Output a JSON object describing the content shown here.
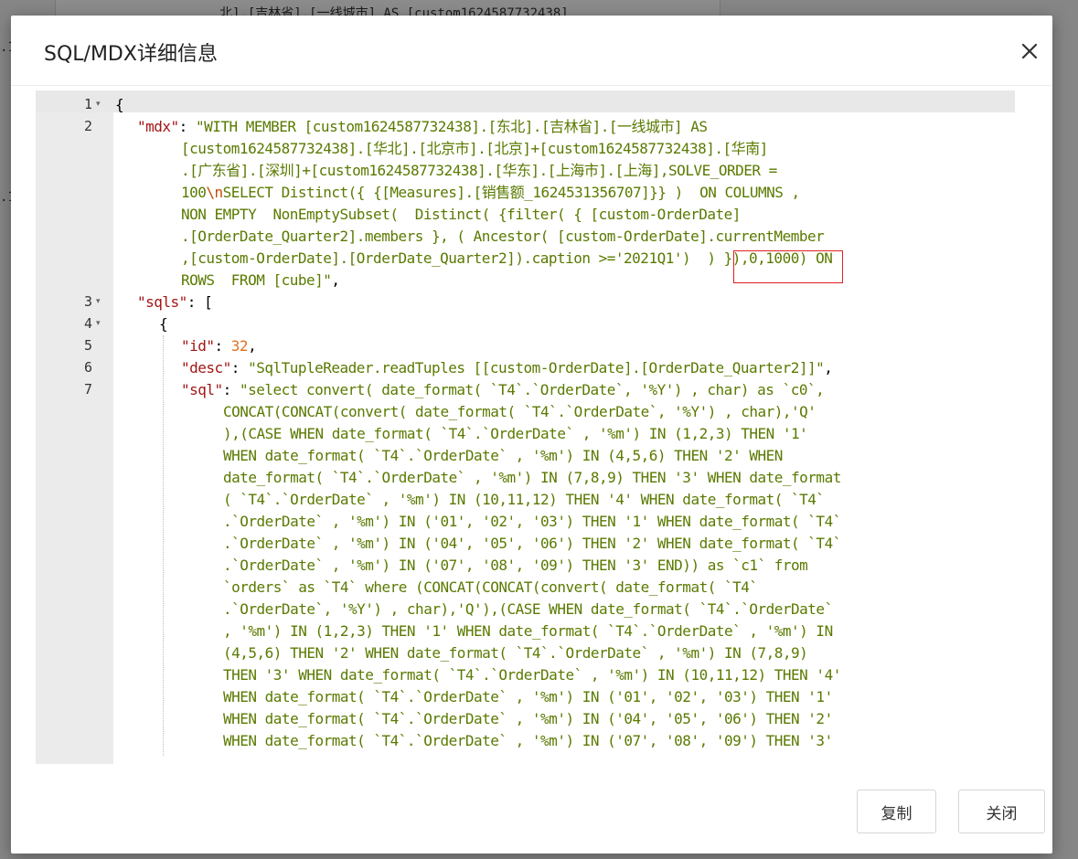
{
  "background": {
    "top_text": "北].[吉林省].[一线城市] AS [custom1624587732438]",
    "side_marks": [
      ".1",
      ".1"
    ]
  },
  "dialog": {
    "title": "SQL/MDX详细信息",
    "close_icon": "close-icon"
  },
  "editor": {
    "line_numbers": [
      "1",
      "2",
      "3",
      "4",
      "5",
      "6",
      "7"
    ],
    "fold_markers": [
      "▾",
      "▾",
      "▾"
    ],
    "lines": [
      {
        "parts": [
          {
            "t": "{",
            "c": ""
          }
        ]
      },
      {
        "parts": [
          {
            "t": "\"mdx\"",
            "c": "k"
          },
          {
            "t": ": ",
            "c": ""
          },
          {
            "t": "\"WITH MEMBER [custom1624587732438].[东北].[吉林省].[一线城市] AS",
            "c": "s"
          }
        ]
      },
      {
        "parts": [
          {
            "t": "[custom1624587732438].[华北].[北京市].[北京]+[custom1624587732438].[华南]",
            "c": "s"
          }
        ]
      },
      {
        "parts": [
          {
            "t": ".[广东省].[深圳]+[custom1624587732438].[华东].[上海市].[上海],SOLVE_ORDER =",
            "c": "s"
          }
        ]
      },
      {
        "parts": [
          {
            "t": "100",
            "c": "s"
          },
          {
            "t": "\\n",
            "c": "esc"
          },
          {
            "t": "SELECT Distinct({ {[Measures].[销售额_1624531356707]}} )  ON COLUMNS ,",
            "c": "s"
          }
        ]
      },
      {
        "parts": [
          {
            "t": "NON EMPTY  NonEmptySubset(  Distinct( {filter( { [custom-OrderDate]",
            "c": "s"
          }
        ]
      },
      {
        "parts": [
          {
            "t": ".[OrderDate_Quarter2].members }, ( Ancestor( [custom-OrderDate].currentMember",
            "c": "s"
          }
        ]
      },
      {
        "parts": [
          {
            "t": ",[custom-OrderDate].[OrderDate_Quarter2]).caption >='2021Q1')  ) }),0,1000) ON",
            "c": "s"
          }
        ]
      },
      {
        "parts": [
          {
            "t": "ROWS  FROM [cube]\"",
            "c": "s"
          },
          {
            "t": ",",
            "c": ""
          }
        ]
      },
      {
        "parts": [
          {
            "t": "\"sqls\"",
            "c": "k"
          },
          {
            "t": ": [",
            "c": ""
          }
        ]
      },
      {
        "parts": [
          {
            "t": "{",
            "c": ""
          }
        ]
      },
      {
        "parts": [
          {
            "t": "\"id\"",
            "c": "k"
          },
          {
            "t": ": ",
            "c": ""
          },
          {
            "t": "32",
            "c": "n"
          },
          {
            "t": ",",
            "c": ""
          }
        ]
      },
      {
        "parts": [
          {
            "t": "\"desc\"",
            "c": "k"
          },
          {
            "t": ": ",
            "c": ""
          },
          {
            "t": "\"SqlTupleReader.readTuples [[custom-OrderDate].[OrderDate_Quarter2]]\"",
            "c": "s"
          },
          {
            "t": ",",
            "c": ""
          }
        ]
      },
      {
        "parts": [
          {
            "t": "\"sql\"",
            "c": "k"
          },
          {
            "t": ": ",
            "c": ""
          },
          {
            "t": "\"select convert( date_format( `T4`.`OrderDate`, '%Y') , char) as `c0`,",
            "c": "s"
          }
        ]
      },
      {
        "parts": [
          {
            "t": "CONCAT(CONCAT(convert( date_format( `T4`.`OrderDate`, '%Y') , char),'Q'",
            "c": "s"
          }
        ]
      },
      {
        "parts": [
          {
            "t": "),(CASE WHEN date_format( `T4`.`OrderDate` , '%m') IN (1,2,3) THEN '1'",
            "c": "s"
          }
        ]
      },
      {
        "parts": [
          {
            "t": "WHEN date_format( `T4`.`OrderDate` , '%m') IN (4,5,6) THEN '2' WHEN",
            "c": "s"
          }
        ]
      },
      {
        "parts": [
          {
            "t": "date_format( `T4`.`OrderDate` , '%m') IN (7,8,9) THEN '3' WHEN date_format",
            "c": "s"
          }
        ]
      },
      {
        "parts": [
          {
            "t": "( `T4`.`OrderDate` , '%m') IN (10,11,12) THEN '4' WHEN date_format( `T4`",
            "c": "s"
          }
        ]
      },
      {
        "parts": [
          {
            "t": ".`OrderDate` , '%m') IN ('01', '02', '03') THEN '1' WHEN date_format( `T4`",
            "c": "s"
          }
        ]
      },
      {
        "parts": [
          {
            "t": ".`OrderDate` , '%m') IN ('04', '05', '06') THEN '2' WHEN date_format( `T4`",
            "c": "s"
          }
        ]
      },
      {
        "parts": [
          {
            "t": ".`OrderDate` , '%m') IN ('07', '08', '09') THEN '3' END)) as `c1` from",
            "c": "s"
          }
        ]
      },
      {
        "parts": [
          {
            "t": "`orders` as `T4` where (CONCAT(CONCAT(convert( date_format( `T4`",
            "c": "s"
          }
        ]
      },
      {
        "parts": [
          {
            "t": ".`OrderDate`, '%Y') , char),'Q'),(CASE WHEN date_format( `T4`.`OrderDate`",
            "c": "s"
          }
        ]
      },
      {
        "parts": [
          {
            "t": ", '%m') IN (1,2,3) THEN '1' WHEN date_format( `T4`.`OrderDate` , '%m') IN",
            "c": "s"
          }
        ]
      },
      {
        "parts": [
          {
            "t": "(4,5,6) THEN '2' WHEN date_format( `T4`.`OrderDate` , '%m') IN (7,8,9)",
            "c": "s"
          }
        ]
      },
      {
        "parts": [
          {
            "t": "THEN '3' WHEN date_format( `T4`.`OrderDate` , '%m') IN (10,11,12) THEN '4'",
            "c": "s"
          }
        ]
      },
      {
        "parts": [
          {
            "t": "WHEN date_format( `T4`.`OrderDate` , '%m') IN ('01', '02', '03') THEN '1'",
            "c": "s"
          }
        ]
      },
      {
        "parts": [
          {
            "t": "WHEN date_format( `T4`.`OrderDate` , '%m') IN ('04', '05', '06') THEN '2'",
            "c": "s"
          }
        ]
      },
      {
        "parts": [
          {
            "t": "WHEN date_format( `T4`.`OrderDate` , '%m') IN ('07', '08', '09') THEN '3'",
            "c": "s"
          }
        ]
      }
    ]
  },
  "footer": {
    "copy_label": "复制",
    "close_label": "关闭"
  },
  "colors": {
    "key": "#a31515",
    "string": "#5a7a00",
    "number": "#e07020",
    "highlight_border": "#e02020"
  }
}
